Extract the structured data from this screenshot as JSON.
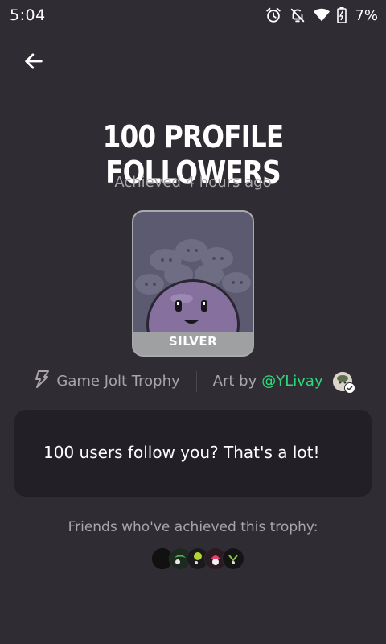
{
  "status_bar": {
    "time": "5:04",
    "battery": "7%",
    "icons": [
      "alarm-icon",
      "notifications-off-icon",
      "wifi-icon",
      "battery-icon"
    ]
  },
  "header": {
    "back_icon": "arrow-left-icon"
  },
  "trophy": {
    "title": "100 PROFILE FOLLOWERS",
    "achieved": "Achieved 4 hours ago",
    "tier": "SILVER",
    "source": "Game Jolt Trophy",
    "art_by_prefix": "Art by",
    "artist": "@YLivay",
    "description": "100 users follow you? That's a lot!"
  },
  "friends": {
    "label": "Friends who've achieved this trophy:",
    "avatar_colors": [
      "#0e0e0e",
      "#2a6b3a",
      "#1c2b1a",
      "#d23a5a",
      "#151515"
    ]
  },
  "colors": {
    "background": "#302c33",
    "card": "#221f26",
    "accent_link": "#2cd97b",
    "muted_text": "#a8a4aa",
    "tier_silver": "#9ea0a1"
  }
}
